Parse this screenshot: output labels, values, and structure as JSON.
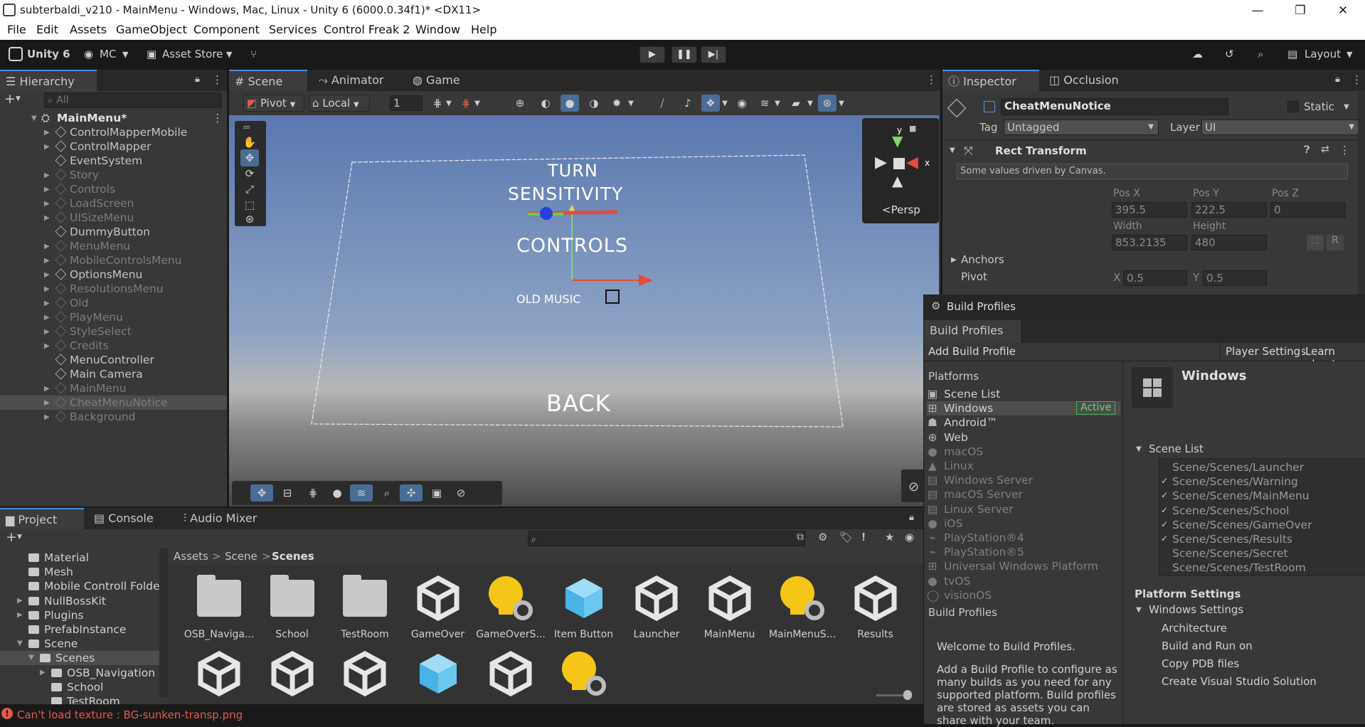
{
  "window": {
    "title": "subterbaldi_v210 - MainMenu - Windows, Mac, Linux - Unity 6 (6000.0.34f1)* <DX11>",
    "minimize": "—",
    "maximize": "❐",
    "close": "✕"
  },
  "menu": [
    "File",
    "Edit",
    "Assets",
    "GameObject",
    "Component",
    "Services",
    "Control Freak 2",
    "Window",
    "Help"
  ],
  "toolbar": {
    "unity": "Unity 6",
    "account": "MC",
    "asset_store": "Asset Store",
    "layout": "Layout"
  },
  "hierarchy": {
    "tab": "Hierarchy",
    "search_placeholder": "All",
    "root": "MainMenu*",
    "items": [
      {
        "label": "ControlMapperMobile",
        "dim": false,
        "arrow": true
      },
      {
        "label": "ControlMapper",
        "dim": false,
        "arrow": true
      },
      {
        "label": "EventSystem",
        "dim": false,
        "arrow": false
      },
      {
        "label": "Story",
        "dim": true,
        "arrow": true
      },
      {
        "label": "Controls",
        "dim": true,
        "arrow": true
      },
      {
        "label": "LoadScreen",
        "dim": true,
        "arrow": true
      },
      {
        "label": "UISizeMenu",
        "dim": true,
        "arrow": true
      },
      {
        "label": "DummyButton",
        "dim": false,
        "arrow": false
      },
      {
        "label": "MenuMenu",
        "dim": true,
        "arrow": true
      },
      {
        "label": "MobileControlsMenu",
        "dim": true,
        "arrow": true
      },
      {
        "label": "OptionsMenu",
        "dim": false,
        "arrow": true
      },
      {
        "label": "ResolutionsMenu",
        "dim": true,
        "arrow": true
      },
      {
        "label": "Old",
        "dim": true,
        "arrow": true
      },
      {
        "label": "PlayMenu",
        "dim": true,
        "arrow": true
      },
      {
        "label": "StyleSelect",
        "dim": true,
        "arrow": true
      },
      {
        "label": "Credits",
        "dim": true,
        "arrow": true
      },
      {
        "label": "MenuController",
        "dim": false,
        "arrow": false
      },
      {
        "label": "Main Camera",
        "dim": false,
        "arrow": false
      },
      {
        "label": "MainMenu",
        "dim": true,
        "arrow": true
      },
      {
        "label": "CheatMenuNotice",
        "dim": true,
        "arrow": true,
        "selected": true
      },
      {
        "label": "Background",
        "dim": true,
        "arrow": true
      }
    ]
  },
  "scene": {
    "tabs": {
      "scene": "Scene",
      "animator": "Animator",
      "game": "Game"
    },
    "pivot": "Pivot",
    "local": "Local",
    "grid_value": "1",
    "texts": {
      "turn": "TURN",
      "sensitivity": "SENSITIVITY",
      "controls": "CONTROLS",
      "old_music": "OLD MUSIC",
      "back": "BACK"
    },
    "persp": "Persp",
    "gizmo_y": "y",
    "gizmo_x": "x"
  },
  "inspector": {
    "tabs": {
      "inspector": "Inspector",
      "occlusion": "Occlusion"
    },
    "name": "CheatMenuNotice",
    "static": "Static",
    "tag_label": "Tag",
    "tag": "Untagged",
    "layer_label": "Layer",
    "layer": "UI",
    "component": "Rect Transform",
    "note": "Some values driven by Canvas.",
    "posx_label": "Pos X",
    "posy_label": "Pos Y",
    "posz_label": "Pos Z",
    "posx": "395.5",
    "posy": "222.5",
    "posz": "0",
    "width_label": "Width",
    "height_label": "Height",
    "width": "853.2135",
    "height": "480",
    "r_button": "R",
    "anchors": "Anchors",
    "pivot": "Pivot",
    "pivot_x_label": "X",
    "pivot_y_label": "Y",
    "pivot_x": "0.5",
    "pivot_y": "0.5"
  },
  "build_profiles": {
    "window_title": "Build Profiles",
    "tab": "Build Profiles",
    "add": "Add Build Profile",
    "player_settings": "Player Settings",
    "learn": "Learn about",
    "platforms_header": "Platforms",
    "platforms": [
      {
        "label": "Scene List",
        "icon": "scene-list-icon",
        "glyph": "▣",
        "dim": false
      },
      {
        "label": "Windows",
        "icon": "windows-icon",
        "glyph": "⊞",
        "dim": false,
        "selected": true,
        "badge": "Active"
      },
      {
        "label": "Android™",
        "icon": "android-icon",
        "glyph": "☗",
        "dim": false
      },
      {
        "label": "Web",
        "icon": "web-icon",
        "glyph": "⊕",
        "dim": false
      },
      {
        "label": "macOS",
        "icon": "apple-icon",
        "glyph": "●",
        "dim": true
      },
      {
        "label": "Linux",
        "icon": "linux-icon",
        "glyph": "▲",
        "dim": true
      },
      {
        "label": "Windows Server",
        "icon": "server-icon",
        "glyph": "▤",
        "dim": true
      },
      {
        "label": "macOS Server",
        "icon": "server-icon",
        "glyph": "▤",
        "dim": true
      },
      {
        "label": "Linux Server",
        "icon": "server-icon",
        "glyph": "▤",
        "dim": true
      },
      {
        "label": "iOS",
        "icon": "apple-icon",
        "glyph": "●",
        "dim": true
      },
      {
        "label": "PlayStation®4",
        "icon": "playstation-icon",
        "glyph": "⌁",
        "dim": true
      },
      {
        "label": "PlayStation®5",
        "icon": "playstation-icon",
        "glyph": "⌁",
        "dim": true
      },
      {
        "label": "Universal Windows Platform",
        "icon": "windows-icon",
        "glyph": "⊞",
        "dim": true
      },
      {
        "label": "tvOS",
        "icon": "apple-icon",
        "glyph": "●",
        "dim": true
      },
      {
        "label": "visionOS",
        "icon": "vision-icon",
        "glyph": "◯",
        "dim": true
      }
    ],
    "build_profiles_header": "Build Profiles",
    "welcome_title": "Welcome to Build Profiles.",
    "welcome_lines": [
      "Add a Build Profile to configure as",
      "many builds as you need for any",
      "supported platform. Build profiles",
      "are stored as assets you can",
      "share with your team."
    ],
    "selected_platform": "Windows",
    "scene_list_header": "Scene List",
    "scenes": [
      {
        "path": "Scene/Scenes/Launcher",
        "checked": false
      },
      {
        "path": "Scene/Scenes/Warning",
        "checked": true
      },
      {
        "path": "Scene/Scenes/MainMenu",
        "checked": true
      },
      {
        "path": "Scene/Scenes/School",
        "checked": true
      },
      {
        "path": "Scene/Scenes/GameOver",
        "checked": true
      },
      {
        "path": "Scene/Scenes/Results",
        "checked": true
      },
      {
        "path": "Scene/Scenes/Secret",
        "checked": false
      },
      {
        "path": "Scene/Scenes/TestRoom",
        "checked": false
      }
    ],
    "platform_settings": "Platform Settings",
    "windows_settings": "Windows Settings",
    "settings": [
      "Architecture",
      "Build and Run on",
      "Copy PDB files",
      "Create Visual Studio Solution"
    ]
  },
  "project": {
    "tabs": {
      "project": "Project",
      "console": "Console",
      "audio": "Audio Mixer"
    },
    "tree": [
      {
        "label": "Material",
        "depth": 1,
        "arrow": false
      },
      {
        "label": "Mesh",
        "depth": 1,
        "arrow": false
      },
      {
        "label": "Mobile Controll Folder",
        "depth": 1,
        "arrow": false
      },
      {
        "label": "NullBossKit",
        "depth": 1,
        "arrow": true
      },
      {
        "label": "Plugins",
        "depth": 1,
        "arrow": true
      },
      {
        "label": "PrefabInstance",
        "depth": 1,
        "arrow": false
      },
      {
        "label": "Scene",
        "depth": 1,
        "arrow": true,
        "open": true
      },
      {
        "label": "Scenes",
        "depth": 2,
        "arrow": true,
        "open": true,
        "selected": true
      },
      {
        "label": "OSB_Navigation",
        "depth": 3,
        "arrow": true
      },
      {
        "label": "School",
        "depth": 3,
        "arrow": false
      },
      {
        "label": "TestRoom",
        "depth": 3,
        "arrow": false
      }
    ],
    "breadcrumb": [
      "Assets",
      "Scene",
      "Scenes"
    ],
    "assets": [
      {
        "label": "OSB_Naviga...",
        "type": "folder"
      },
      {
        "label": "School",
        "type": "folder"
      },
      {
        "label": "TestRoom",
        "type": "folder"
      },
      {
        "label": "GameOver",
        "type": "unity"
      },
      {
        "label": "GameOverS...",
        "type": "light"
      },
      {
        "label": "Item Button",
        "type": "cube"
      },
      {
        "label": "Launcher",
        "type": "unity"
      },
      {
        "label": "MainMenu",
        "type": "unity"
      },
      {
        "label": "MainMenuS...",
        "type": "light"
      },
      {
        "label": "Results",
        "type": "unity"
      }
    ],
    "row2": [
      "unity",
      "unity",
      "unity",
      "cube",
      "unity",
      "light"
    ]
  },
  "status": {
    "error": "Can't load texture : BG-sunken-transp.png"
  },
  "colors": {
    "accent": "#4a8fd9",
    "error": "#e05a4a",
    "active_badge": "#3fb34f",
    "selection": "#2c5d87"
  }
}
